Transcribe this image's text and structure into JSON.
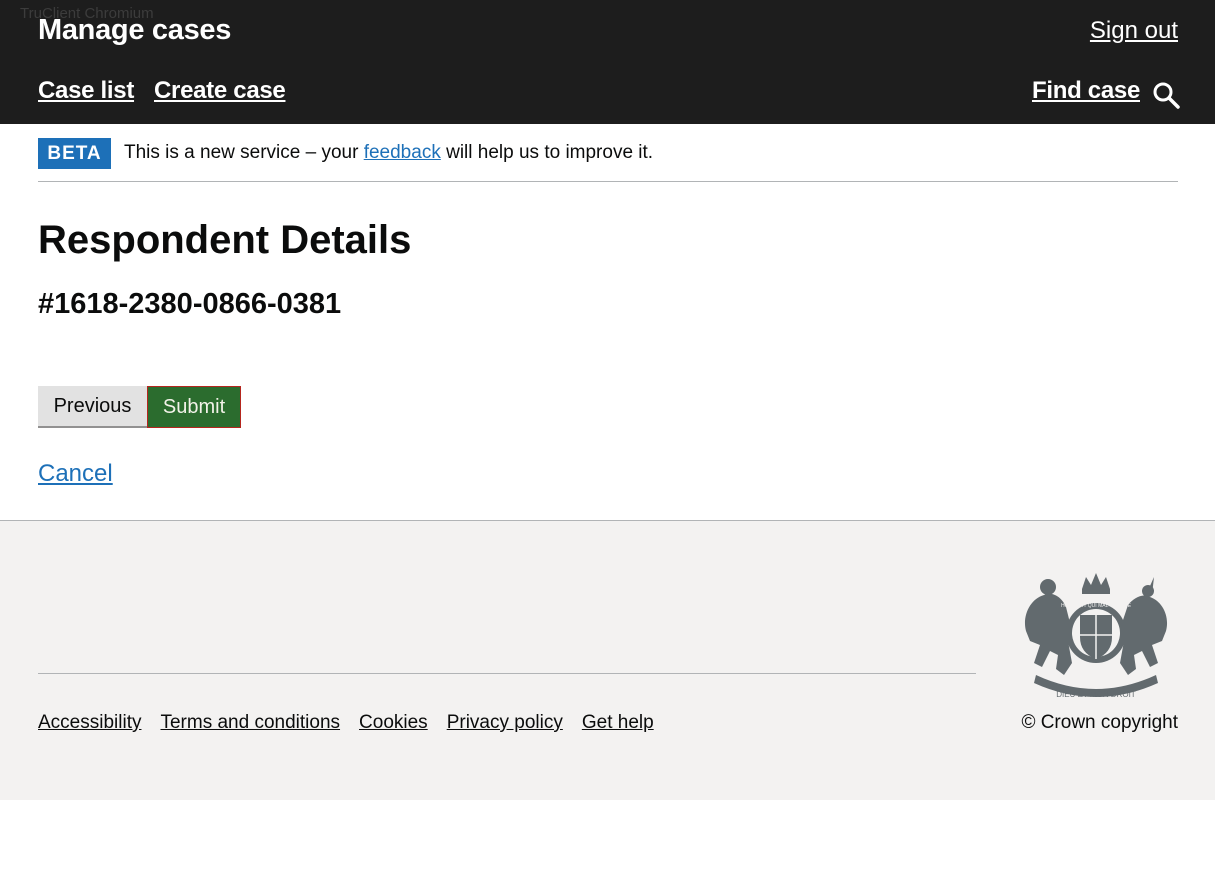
{
  "browser": {
    "watermark": "TruClient Chromium"
  },
  "header": {
    "service_name": "Manage cases",
    "sign_out": "Sign out",
    "nav": {
      "case_list": "Case list",
      "create_case": "Create case",
      "find_case": "Find case"
    },
    "search_icon": "search-icon"
  },
  "phase_banner": {
    "tag": "BETA",
    "text_before": "This is a new service – your ",
    "link": "feedback",
    "text_after": " will help us to improve it."
  },
  "main": {
    "title": "Respondent Details",
    "case_reference": "#1618-2380-0866-0381",
    "previous_label": "Previous",
    "submit_label": "Submit",
    "cancel_label": "Cancel"
  },
  "footer": {
    "links": [
      "Accessibility",
      "Terms and conditions",
      "Cookies",
      "Privacy policy",
      "Get help"
    ],
    "copyright": "© Crown copyright",
    "crest_text": [
      "DIEU ET MON DROIT",
      "HONI SOIT QUI MAL Y PENSE"
    ]
  },
  "colors": {
    "header_bg": "#1d1d1d",
    "beta_tag": "#1d70b8",
    "link": "#1d70b8",
    "submit_bg": "#2b6c2e",
    "submit_border": "#b5261e",
    "footer_bg": "#f3f2f1"
  }
}
